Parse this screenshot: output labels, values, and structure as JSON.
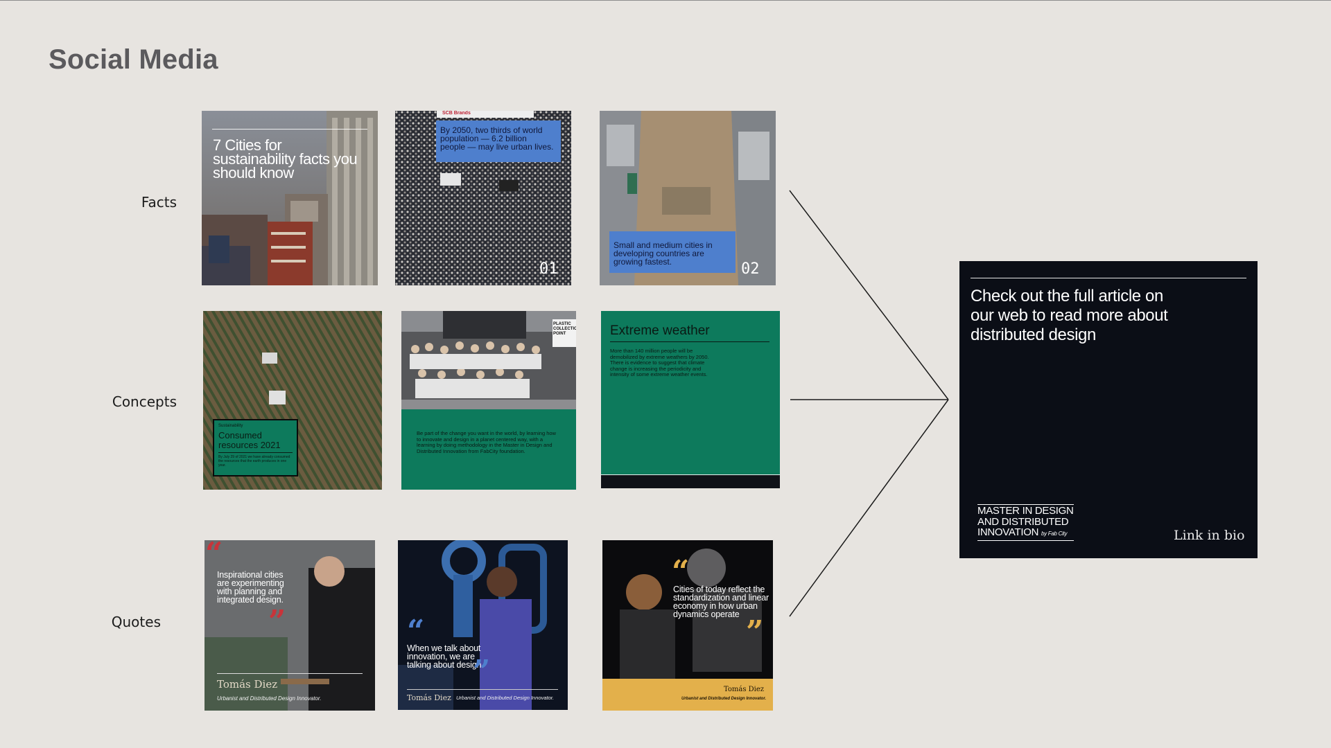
{
  "page": {
    "title": "Social Media"
  },
  "rows": {
    "facts": "Facts",
    "concepts": "Concepts",
    "quotes": "Quotes"
  },
  "facts": {
    "tile1_title": "7 Cities for sustainability facts you should know",
    "tile2_text": "By 2050, two thirds of world population — 6.2 billion people — may live urban lives.",
    "tile2_number": "01",
    "tile2_sign": "SCB Brands",
    "tile3_text": "Small and medium cities in developing countries are growing fastest.",
    "tile3_number": "02"
  },
  "concepts": {
    "tile1_kicker": "Sustainability",
    "tile1_title": "Consumed resources 2021",
    "tile1_body": "By July 29 of 2021 we have already consumed the resources that the earth produces in one year.",
    "tile2_sign": "PLASTIC COLLECTION POINT",
    "tile2_body": "Be part of the change you want in the world, by learning how to innovate and design in a planet centered way, with a learning by doing methodology in the Master in Design and Distributed Innovation from FabCity foundation.",
    "tile3_title": "Extreme weather",
    "tile3_body": "More than 140 million people will be demobilized by extreme weathers by 2050. There is evidence to suggest that climate change is increasing the periodicity and intensity of some extreme weather events."
  },
  "quotes": {
    "tile1_quote": "Inspirational cities are experimenting with planning and integrated design.",
    "tile1_name": "Tomás Diez",
    "tile1_role": "Urbanist and Distributed Design Innovator.",
    "tile2_quote": "When we talk about innovation, we are talking about design.",
    "tile2_name": "Tomás Diez",
    "tile2_role": "Urbanist and Distributed Design Innovator.",
    "tile3_quote": "Cities of today reflect the standardization and linear economy in how urban dynamics operate",
    "tile3_name": "Tomás Diez",
    "tile3_role": "Urbanist and Distributed Design Innovator."
  },
  "cta": {
    "headline": "Check out the full article on our web to read more about distributed design",
    "logo_line1": "MASTER IN DESIGN",
    "logo_line2": "AND DISTRIBUTED",
    "logo_line3": "INNOVATION",
    "logo_by": "by Fab City",
    "link": "Link in bio"
  },
  "colors": {
    "background": "#e7e4e0",
    "title": "#5b5a5d",
    "blue_box": "#4e7fcd",
    "green": "#0d7a5c",
    "dark": "#0b0e16",
    "yellow": "#e3b04b",
    "red_quote": "#c8343a"
  }
}
